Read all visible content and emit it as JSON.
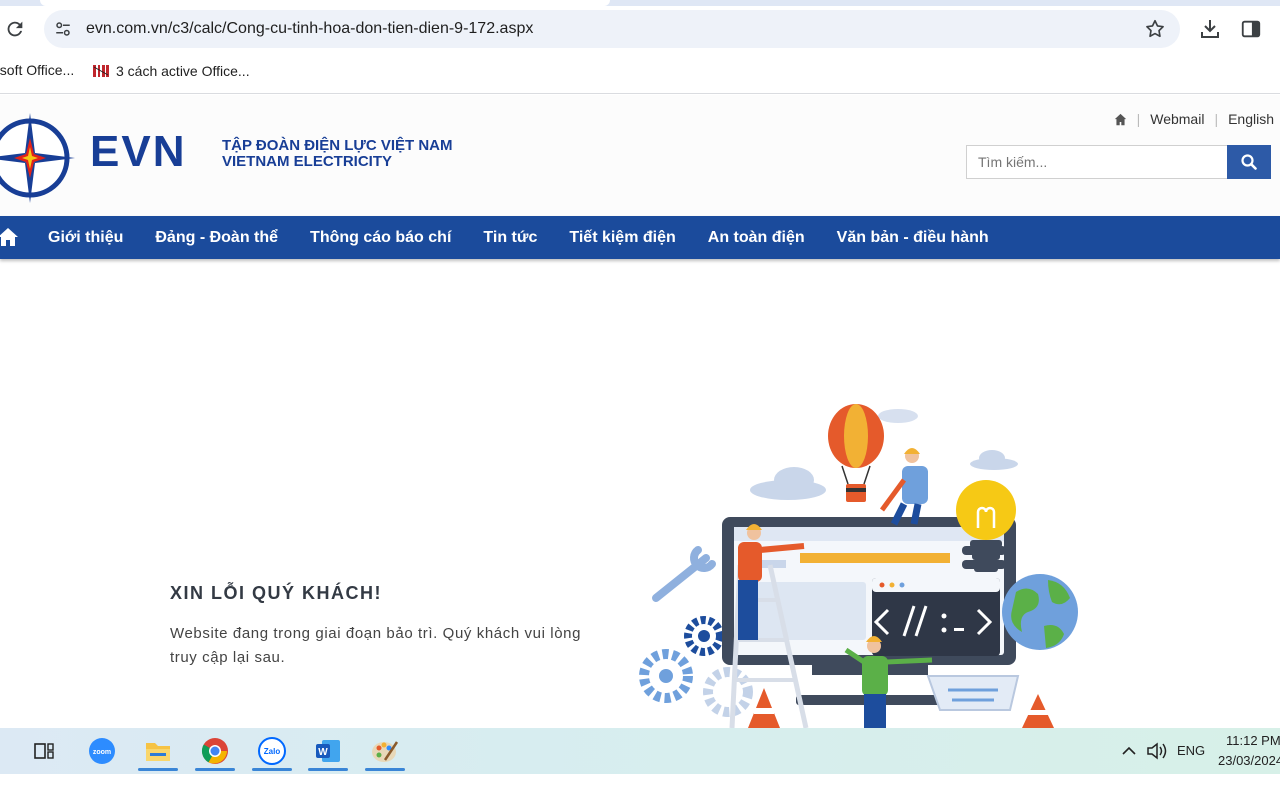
{
  "browser": {
    "url": "evn.com.vn/c3/calc/Cong-cu-tinh-hoa-don-tien-dien-9-172.aspx",
    "bookmarks": [
      {
        "label": "osoft Office..."
      },
      {
        "label": "3 cách active Office..."
      }
    ]
  },
  "header": {
    "logo_text": "EVN",
    "org_name_vi": "TẬP ĐOÀN ĐIỆN LỰC VIỆT NAM",
    "org_name_en": "VIETNAM ELECTRICITY",
    "links": {
      "webmail": "Webmail",
      "english": "English"
    },
    "search": {
      "placeholder": "Tìm kiếm..."
    }
  },
  "nav": {
    "items": [
      {
        "label": "Giới thiệu"
      },
      {
        "label": "Đảng - Đoàn thể"
      },
      {
        "label": "Thông cáo báo chí"
      },
      {
        "label": "Tin tức"
      },
      {
        "label": "Tiết kiệm điện"
      },
      {
        "label": "An toàn điện"
      },
      {
        "label": "Văn bản - điều hành"
      }
    ]
  },
  "main": {
    "title": "XIN LỖI QUÝ KHÁCH!",
    "message": "Website đang trong giai đoạn bảo trì. Quý khách vui lòng truy cập lại sau."
  },
  "taskbar": {
    "apps": [
      {
        "icon": "task-view-icon"
      },
      {
        "icon": "zoom-icon",
        "label": "zoom"
      },
      {
        "icon": "file-explorer-icon"
      },
      {
        "icon": "chrome-icon"
      },
      {
        "icon": "zalo-icon",
        "label": "Zalo"
      },
      {
        "icon": "word-icon",
        "label": "W"
      },
      {
        "icon": "paint-icon"
      }
    ],
    "tray": {
      "lang": "ENG",
      "time": "11:12 PM",
      "date": "23/03/2024"
    }
  },
  "colors": {
    "brand_blue": "#1b4b9c",
    "brand_dark_blue": "#183e96",
    "brand_red": "#e2231a",
    "search_button": "#2d5aa7"
  }
}
